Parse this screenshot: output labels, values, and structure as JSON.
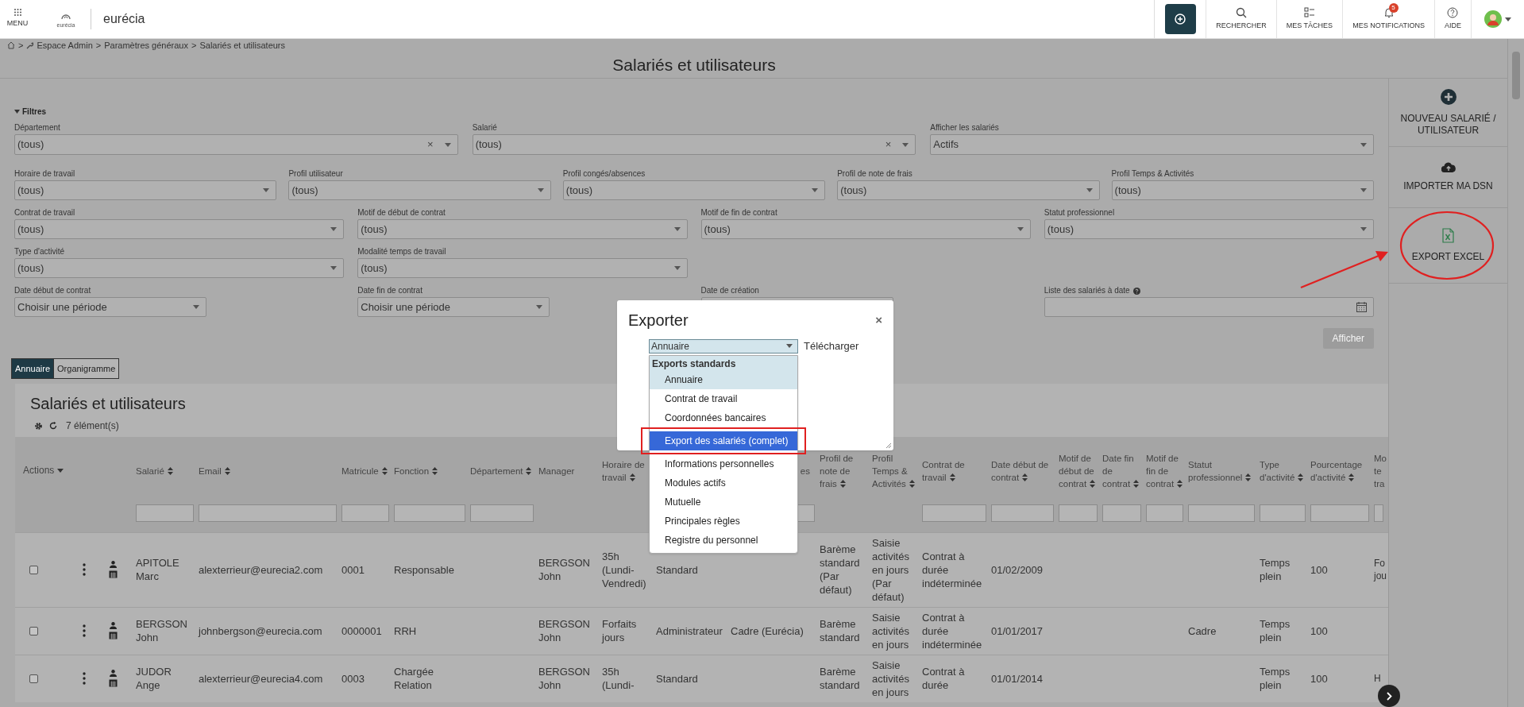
{
  "topbar": {
    "menu_label": "MENU",
    "logo_caption": "eurécia",
    "brand": "eurécia",
    "actions": [
      {
        "label": "RECHERCHER",
        "kind": "search"
      },
      {
        "label": "MES TÂCHES",
        "kind": "tasks"
      },
      {
        "label": "MES NOTIFICATIONS",
        "kind": "bell",
        "badge": "5"
      },
      {
        "label": "AIDE",
        "kind": "help"
      }
    ]
  },
  "breadcrumb": {
    "separator": ">",
    "items": [
      "Espace Admin",
      "Paramètres généraux",
      "Salariés et utilisateurs"
    ]
  },
  "page_title": "Salariés et utilisateurs",
  "sidebar": [
    {
      "label": "NOUVEAU SALARIÉ / UTILISATEUR",
      "kind": "add",
      "highlighted": false
    },
    {
      "label": "IMPORTER MA DSN",
      "kind": "upload",
      "highlighted": false
    },
    {
      "label": "EXPORT EXCEL",
      "kind": "excel",
      "highlighted": true
    }
  ],
  "filters": {
    "title": "Filtres",
    "filter_rows": [
      {
        "fields": [
          {
            "label": "Département",
            "value": "(tous)",
            "kind": "select_clear",
            "clear": "×"
          },
          {
            "label": "Salarié",
            "value": "(tous)",
            "kind": "select_clear",
            "clear": "×"
          },
          {
            "label": "Afficher les salariés",
            "value": "Actifs",
            "kind": "select"
          }
        ]
      },
      {
        "fields": [
          {
            "label": "Horaire de travail",
            "value": "(tous)",
            "kind": "select"
          },
          {
            "label": "Profil utilisateur",
            "value": "(tous)",
            "kind": "select"
          },
          {
            "label": "Profil congés/absences",
            "value": "(tous)",
            "kind": "select"
          },
          {
            "label": "Profil de note de frais",
            "value": "(tous)",
            "kind": "select"
          },
          {
            "label": "Profil Temps & Activités",
            "value": "(tous)",
            "kind": "select"
          }
        ]
      },
      {
        "fields": [
          {
            "label": "Contrat de travail",
            "value": "(tous)",
            "kind": "select"
          },
          {
            "label": "Motif de début de contrat",
            "value": "(tous)",
            "kind": "select"
          },
          {
            "label": "Motif de fin de contrat",
            "value": "(tous)",
            "kind": "select"
          },
          {
            "label": "Statut professionnel",
            "value": "(tous)",
            "kind": "select"
          }
        ]
      },
      {
        "fields": [
          {
            "label": "Type d'activité",
            "value": "(tous)",
            "kind": "select"
          },
          {
            "label": "Modalité temps de travail",
            "value": "(tous)",
            "kind": "select"
          }
        ]
      },
      {
        "fields": [
          {
            "label": "Date début de contrat",
            "value": "Choisir une période",
            "kind": "period"
          },
          {
            "label": "Date fin de contrat",
            "value": "Choisir une période",
            "kind": "period"
          },
          {
            "label": "Date de création",
            "kind": "text"
          },
          {
            "label": "Liste des salariés à date",
            "kind": "date",
            "help": true
          }
        ]
      }
    ],
    "apply_button": {
      "label": "Afficher",
      "disabled": true
    }
  },
  "view_tabs": [
    {
      "label": "Annuaire",
      "selected": true
    },
    {
      "label": "Organigramme",
      "selected": false
    }
  ],
  "table": {
    "title": "Salariés et utilisateurs",
    "count": "7 élément(s)",
    "actions_label": "Actions",
    "columns": [
      {
        "label": "Salarié",
        "sortable": true,
        "filter": true
      },
      {
        "label": "Email",
        "sortable": true,
        "filter": true
      },
      {
        "label": "Matricule",
        "sortable": true,
        "filter": true
      },
      {
        "label": "Fonction",
        "sortable": true,
        "filter": true
      },
      {
        "label": "Département",
        "sortable": true,
        "filter": true
      },
      {
        "label": "Manager",
        "sortable": false,
        "filter": false
      },
      {
        "label": "Horaire de travail",
        "sortable": true,
        "filter": false
      },
      {},
      {
        "label": "es",
        "sortable": false,
        "filter": true
      },
      {
        "label": "Profil de note de frais",
        "sortable": true,
        "filter": false
      },
      {
        "label": "Profil Temps & Activités",
        "sortable": true,
        "filter": false
      },
      {
        "label": "Contrat de travail",
        "sortable": true,
        "filter": true
      },
      {
        "label": "Date début de contrat",
        "sortable": true,
        "filter": true
      },
      {
        "label": "Motif de début de contrat",
        "sortable": true,
        "filter": true
      },
      {
        "label": "Date fin de contrat",
        "sortable": true,
        "filter": true
      },
      {
        "label": "Motif de fin de contrat",
        "sortable": true,
        "filter": true
      },
      {
        "label": "Statut professionnel",
        "sortable": true,
        "filter": true
      },
      {
        "label": "Type d'activité",
        "sortable": true,
        "filter": true
      },
      {
        "label": "Pourcentage d'activité",
        "sortable": true,
        "filter": true
      },
      {
        "label": "Mo te tra",
        "sortable": false,
        "filter": true
      }
    ],
    "rows": [
      {
        "checked": false,
        "cells": [
          "APITOLE Marc",
          "alexterrieur@eurecia2.com",
          "0001",
          "Responsable",
          "",
          "BERGSON John",
          "35h (Lundi-Vendredi)",
          "Standard",
          "",
          "Barème standard (Par défaut)",
          "Saisie activités en jours (Par défaut)",
          "Contrat à durée indéterminée",
          "01/02/2009",
          "",
          "",
          "",
          "",
          "Temps plein",
          "100",
          "Fo jou"
        ]
      },
      {
        "checked": false,
        "cells": [
          "BERGSON John",
          "johnbergson@eurecia.com",
          "0000001",
          "RRH",
          "",
          "BERGSON John",
          "Forfaits jours",
          "Administrateur",
          "Cadre (Eurécia)",
          "Barème standard",
          "Saisie activités en jours",
          "Contrat à durée indéterminée",
          "01/01/2017",
          "",
          "",
          "",
          "Cadre",
          "Temps plein",
          "100",
          ""
        ]
      },
      {
        "checked": false,
        "cells": [
          "JUDOR Ange",
          "alexterrieur@eurecia4.com",
          "0003",
          "Chargée Relation",
          "",
          "BERGSON John",
          "35h (Lundi-",
          "Standard",
          "",
          "Barème standard",
          "Saisie activités en jours",
          "Contrat à durée",
          "01/01/2014",
          "",
          "",
          "",
          "",
          "Temps plein",
          "100",
          "H"
        ]
      }
    ]
  },
  "modal": {
    "title": "Exporter",
    "close": "×",
    "select_value": "Annuaire",
    "download_label": "Télécharger",
    "group_label": "Exports standards",
    "options": [
      {
        "label": "Annuaire",
        "current": true,
        "selected": false,
        "highlighted": false
      },
      {
        "label": "Contrat de travail",
        "current": false,
        "selected": false,
        "highlighted": false
      },
      {
        "label": "Coordonnées bancaires",
        "current": false,
        "selected": false,
        "highlighted": false
      },
      {
        "label": "Export des salariés (complet)",
        "current": false,
        "selected": true,
        "highlighted": true
      },
      {
        "label": "Informations personnelles",
        "current": false,
        "selected": false,
        "highlighted": false
      },
      {
        "label": "Modules actifs",
        "current": false,
        "selected": false,
        "highlighted": false
      },
      {
        "label": "Mutuelle",
        "current": false,
        "selected": false,
        "highlighted": false
      },
      {
        "label": "Principales règles",
        "current": false,
        "selected": false,
        "highlighted": false
      },
      {
        "label": "Registre du personnel",
        "current": false,
        "selected": false,
        "highlighted": false
      }
    ]
  }
}
